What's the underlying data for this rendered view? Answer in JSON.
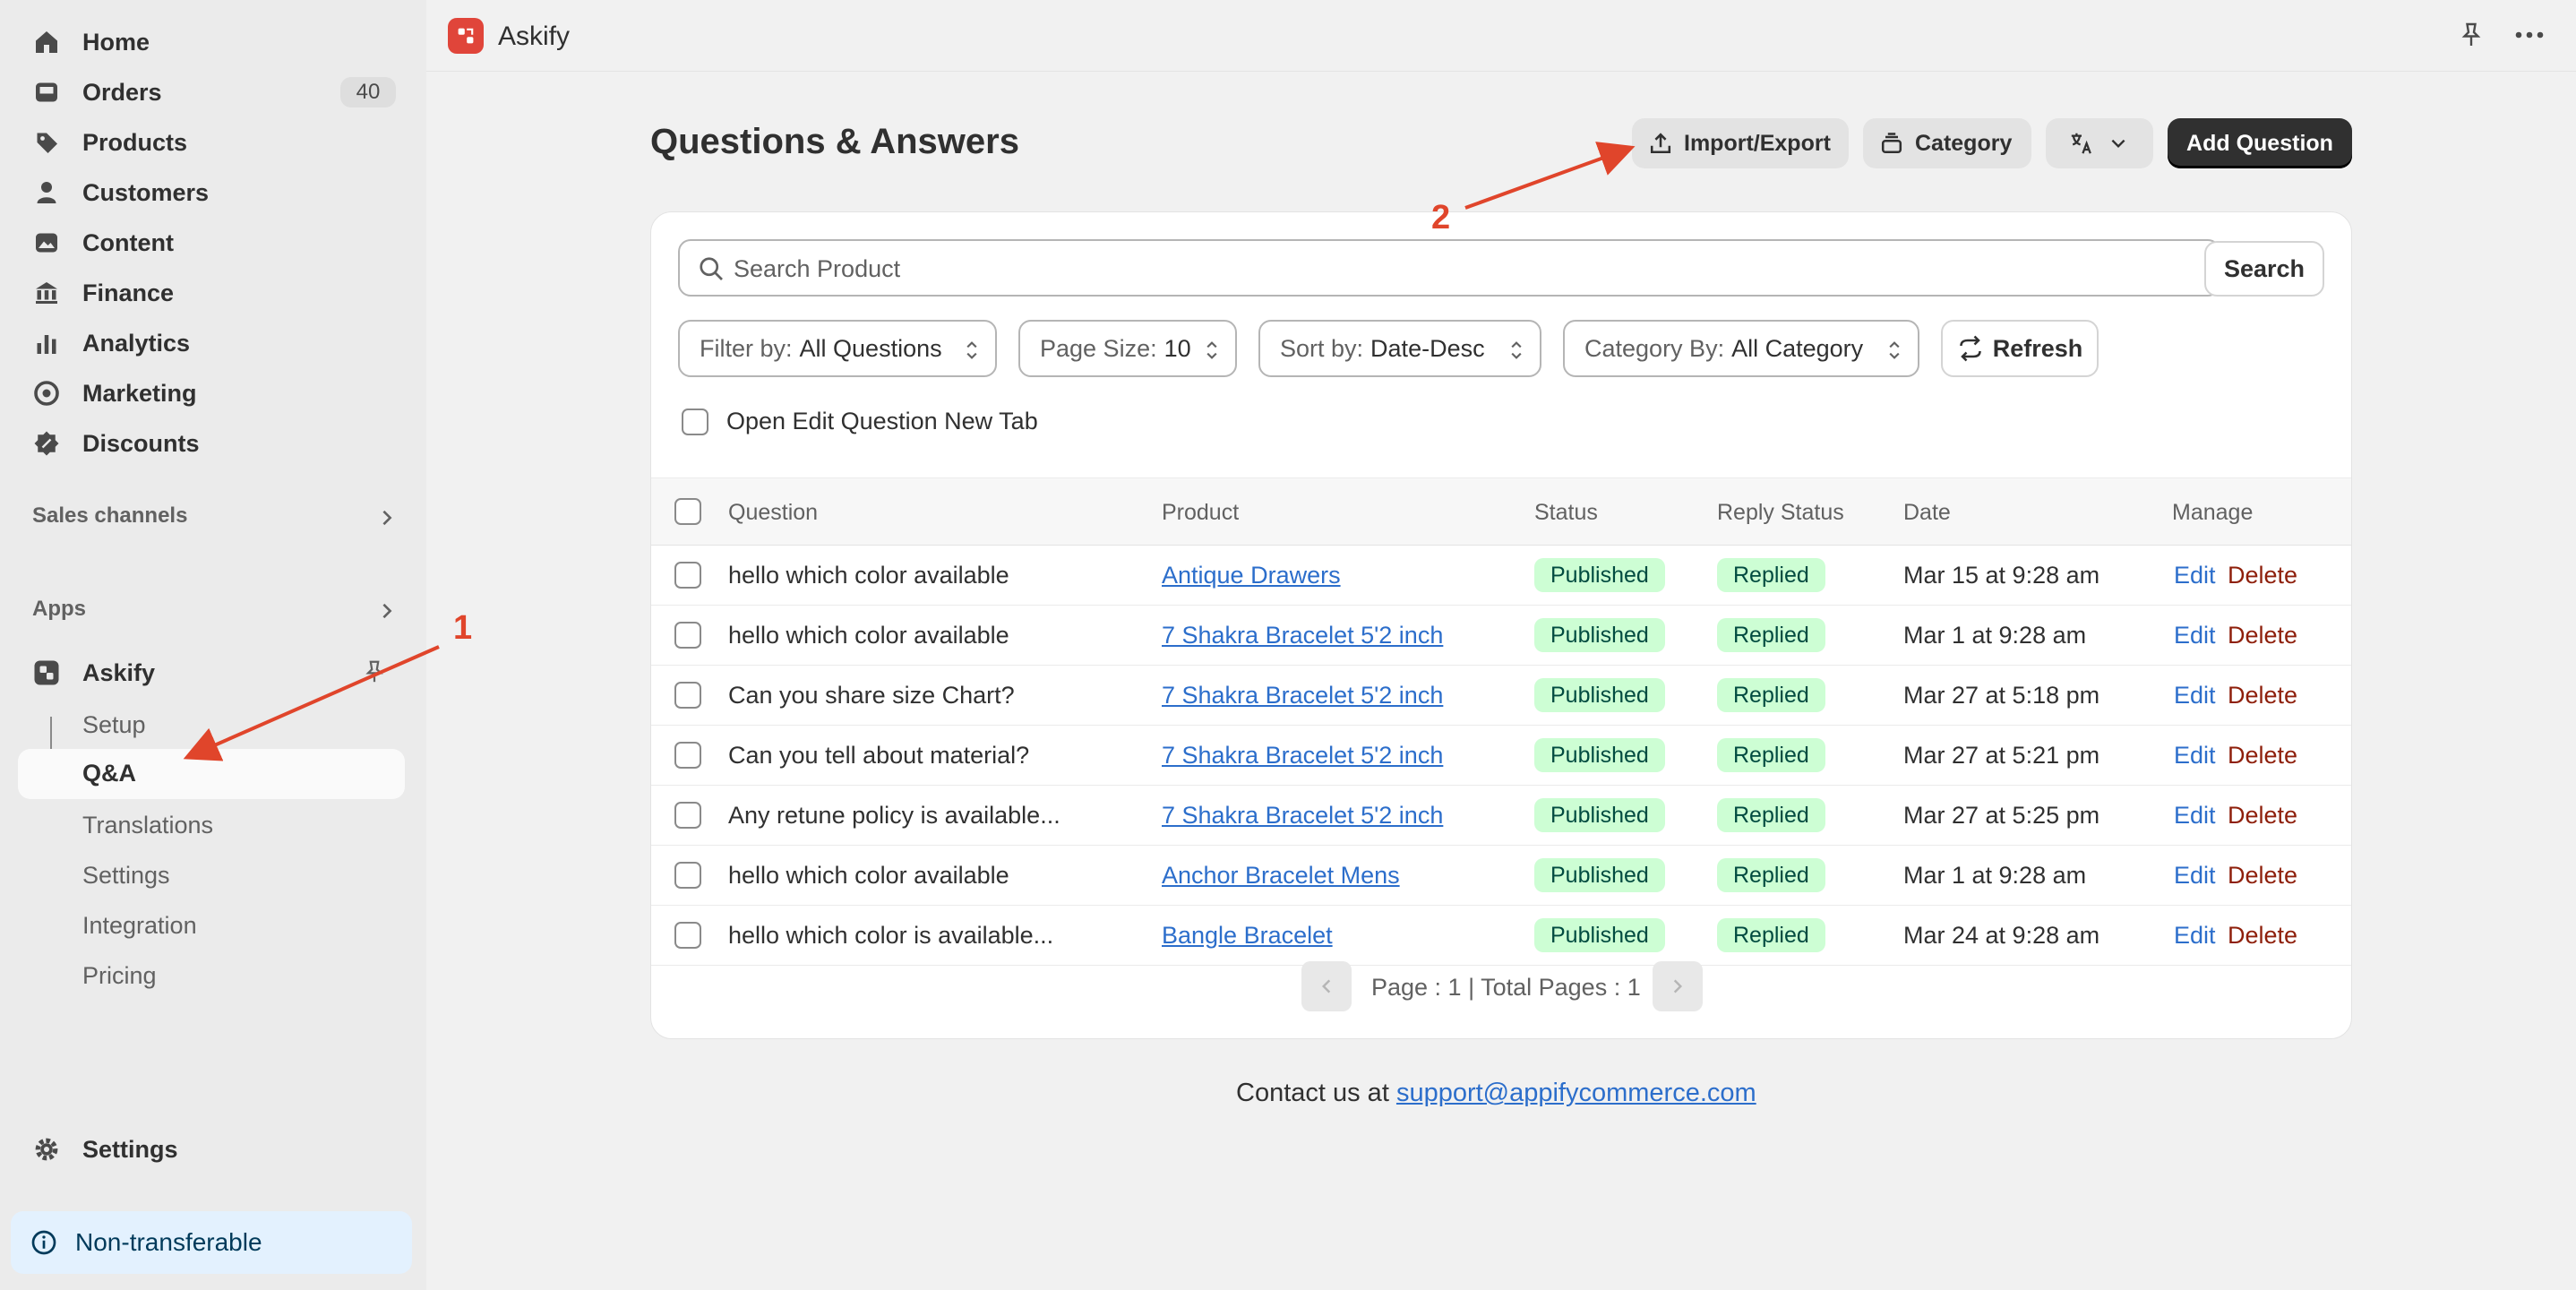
{
  "sidebar": {
    "nav": [
      {
        "label": "Home",
        "icon": "home-icon"
      },
      {
        "label": "Orders",
        "icon": "inbox-icon",
        "badge": "40"
      },
      {
        "label": "Products",
        "icon": "tag-icon"
      },
      {
        "label": "Customers",
        "icon": "person-icon"
      },
      {
        "label": "Content",
        "icon": "image-icon"
      },
      {
        "label": "Finance",
        "icon": "bank-icon"
      },
      {
        "label": "Analytics",
        "icon": "bar-chart-icon"
      },
      {
        "label": "Marketing",
        "icon": "target-icon"
      },
      {
        "label": "Discounts",
        "icon": "discount-icon"
      }
    ],
    "sales_channels": "Sales channels",
    "apps": "Apps",
    "app_name": "Askify",
    "app_sub": [
      "Setup",
      "Q&A",
      "Translations",
      "Settings",
      "Integration",
      "Pricing"
    ],
    "settings": "Settings",
    "non_transferable": "Non-transferable"
  },
  "topbar": {
    "app_name": "Askify"
  },
  "header": {
    "title": "Questions & Answers",
    "import_export": "Import/Export",
    "category": "Category",
    "add_question": "Add Question"
  },
  "search": {
    "placeholder": "Search Product",
    "button": "Search"
  },
  "filters": [
    {
      "label": "Filter by:",
      "value": "All Questions"
    },
    {
      "label": "Page Size:",
      "value": "10"
    },
    {
      "label": "Sort by:",
      "value": "Date-Desc"
    },
    {
      "label": "Category By:",
      "value": "All Category"
    }
  ],
  "refresh": "Refresh",
  "open_edit_tab": "Open Edit Question New Tab",
  "table": {
    "columns": [
      "Question",
      "Product",
      "Status",
      "Reply Status",
      "Date",
      "Manage"
    ],
    "rows": [
      {
        "question": "hello which color available",
        "product": "Antique Drawers",
        "status": "Published",
        "reply": "Replied",
        "date": "Mar 15 at 9:28 am"
      },
      {
        "question": "hello which color available",
        "product": "7 Shakra Bracelet 5'2 inch",
        "status": "Published",
        "reply": "Replied",
        "date": "Mar 1 at 9:28 am"
      },
      {
        "question": "Can you share size Chart?",
        "product": "7 Shakra Bracelet 5'2 inch",
        "status": "Published",
        "reply": "Replied",
        "date": "Mar 27 at 5:18 pm"
      },
      {
        "question": "Can you tell about material?",
        "product": "7 Shakra Bracelet 5'2 inch",
        "status": "Published",
        "reply": "Replied",
        "date": "Mar 27 at 5:21 pm"
      },
      {
        "question": "Any retune policy is available...",
        "product": "7 Shakra Bracelet 5'2 inch",
        "status": "Published",
        "reply": "Replied",
        "date": "Mar 27 at 5:25 pm"
      },
      {
        "question": "hello which color available",
        "product": "Anchor Bracelet Mens",
        "status": "Published",
        "reply": "Replied",
        "date": "Mar 1 at 9:28 am"
      },
      {
        "question": "hello which color is available...",
        "product": "Bangle Bracelet",
        "status": "Published",
        "reply": "Replied",
        "date": "Mar 24 at 9:28 am"
      }
    ],
    "edit": "Edit",
    "delete": "Delete"
  },
  "pager": {
    "text": "Page : 1 | Total Pages : 1"
  },
  "contact": {
    "prefix": "Contact us at",
    "email": "support@appifycommerce.com"
  },
  "annotations": {
    "one": "1",
    "two": "2"
  },
  "colors": {
    "accent": "#2c6ecb",
    "annotation": "#e0452b",
    "published_bg": "#cdfed4",
    "primary_btn": "#303030"
  }
}
